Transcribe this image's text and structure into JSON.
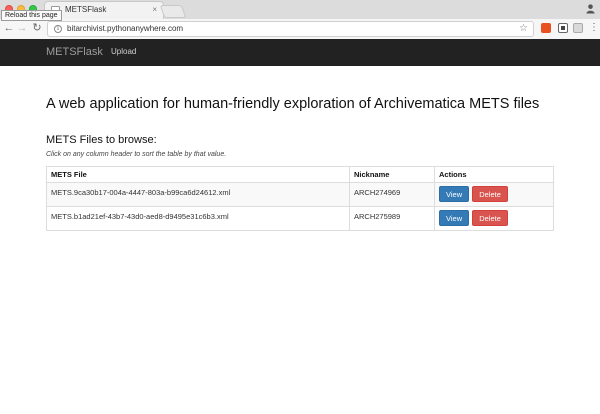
{
  "browser": {
    "tab_title": "METSFlask",
    "tab_close": "×",
    "tooltip": "Reload this page",
    "url": "bitarchivist.pythonanywhere.com"
  },
  "navbar": {
    "brand": "METSFlask",
    "upload": "Upload"
  },
  "page": {
    "headline": "A web application for human-friendly exploration of Archivematica METS files",
    "subhead": "METS Files to browse:",
    "hint": "Click on any column header to sort the table by that value."
  },
  "table": {
    "headers": [
      "METS File",
      "Nickname",
      "Actions"
    ],
    "rows": [
      {
        "file": "METS.9ca30b17-004a-4447-803a-b99ca6d24612.xml",
        "nickname": "ARCH274969"
      },
      {
        "file": "METS.b1ad21ef-43b7-43d0-aed8-d9495e31c6b3.xml",
        "nickname": "ARCH275989"
      }
    ],
    "view_label": "View",
    "delete_label": "Delete"
  },
  "colors": {
    "navbar": "#222222",
    "view_button": "#337ab7",
    "delete_button": "#d9534f"
  },
  "icons": [
    "back-icon",
    "forward-icon",
    "reload-icon",
    "info-icon",
    "star-icon",
    "menu-icon",
    "profile-icon"
  ]
}
